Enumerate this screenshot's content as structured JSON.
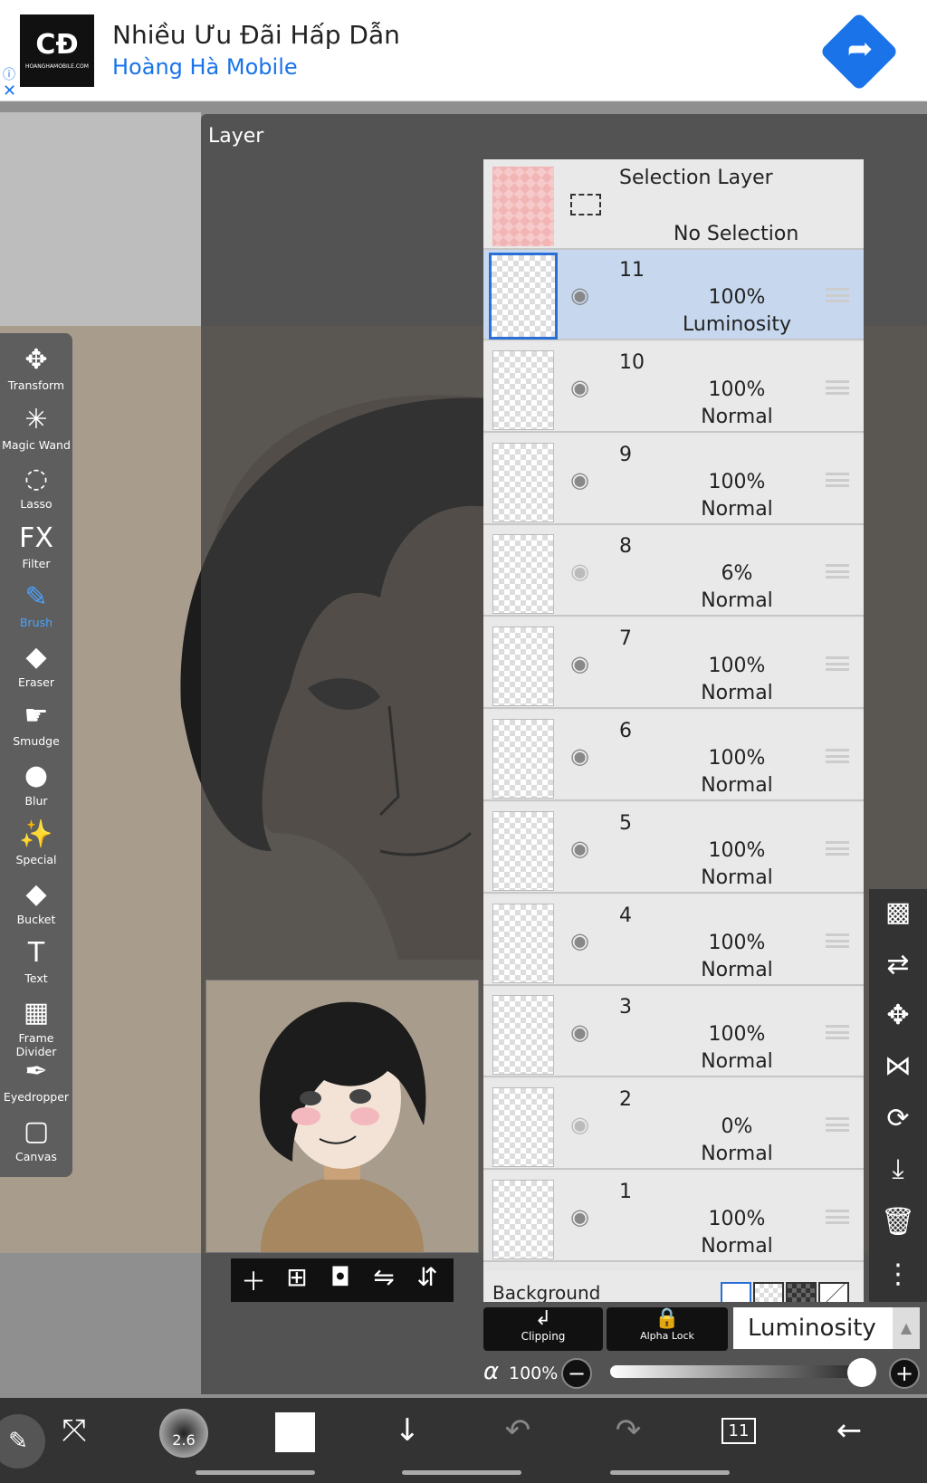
{
  "ad": {
    "title": "Nhiều Ưu Đãi Hấp Dẫn",
    "subtitle": "Hoàng Hà Mobile",
    "logo_text": "CĐ",
    "logo_small": "HOANGHAMOBILE.COM"
  },
  "panel": {
    "title": "Layer"
  },
  "tools": [
    {
      "label": "Transform",
      "icon": "move-icon",
      "glyph": "✥"
    },
    {
      "label": "Magic Wand",
      "icon": "magic-wand-icon",
      "glyph": "✳"
    },
    {
      "label": "Lasso",
      "icon": "lasso-icon",
      "glyph": "◌"
    },
    {
      "label": "Filter",
      "icon": "fx-icon",
      "glyph": "FX"
    },
    {
      "label": "Brush",
      "icon": "brush-icon",
      "glyph": "✎"
    },
    {
      "label": "Eraser",
      "icon": "eraser-icon",
      "glyph": "◆"
    },
    {
      "label": "Smudge",
      "icon": "smudge-icon",
      "glyph": "☛"
    },
    {
      "label": "Blur",
      "icon": "blur-icon",
      "glyph": "●"
    },
    {
      "label": "Special",
      "icon": "special-icon",
      "glyph": "✨"
    },
    {
      "label": "Bucket",
      "icon": "bucket-icon",
      "glyph": "◆"
    },
    {
      "label": "Text",
      "icon": "text-icon",
      "glyph": "T"
    },
    {
      "label": "Frame Divider",
      "icon": "frame-divider-icon",
      "glyph": "▦"
    },
    {
      "label": "Eyedropper",
      "icon": "eyedropper-icon",
      "glyph": "✒"
    },
    {
      "label": "Canvas",
      "icon": "canvas-icon",
      "glyph": "▢"
    }
  ],
  "selection_layer": {
    "title": "Selection Layer",
    "status": "No Selection"
  },
  "layers": [
    {
      "num": "11",
      "opacity": "100%",
      "mode": "Luminosity",
      "visible": true,
      "selected": true
    },
    {
      "num": "10",
      "opacity": "100%",
      "mode": "Normal",
      "visible": true
    },
    {
      "num": "9",
      "opacity": "100%",
      "mode": "Normal",
      "visible": true
    },
    {
      "num": "8",
      "opacity": "6%",
      "mode": "Normal",
      "visible": false
    },
    {
      "num": "7",
      "opacity": "100%",
      "mode": "Normal",
      "visible": true
    },
    {
      "num": "6",
      "opacity": "100%",
      "mode": "Normal",
      "visible": true
    },
    {
      "num": "5",
      "opacity": "100%",
      "mode": "Normal",
      "visible": true
    },
    {
      "num": "4",
      "opacity": "100%",
      "mode": "Normal",
      "visible": true
    },
    {
      "num": "3",
      "opacity": "100%",
      "mode": "Normal",
      "visible": true
    },
    {
      "num": "2",
      "opacity": "0%",
      "mode": "Normal",
      "visible": false
    },
    {
      "num": "1",
      "opacity": "100%",
      "mode": "Normal",
      "visible": true
    }
  ],
  "background": {
    "label": "Background"
  },
  "controls": {
    "clipping": "Clipping",
    "alpha_lock": "Alpha Lock",
    "blend_mode": "Luminosity",
    "alpha_symbol": "α",
    "opacity": "100%",
    "opacity_value": 1.0
  },
  "bottom": {
    "brush_size": "2.6",
    "layer_count": "11"
  },
  "colors": {
    "selected_row": "#c7d8ee",
    "accent": "#4aa3ff",
    "canvas_bg": "#a89c8d",
    "skin": "#a6875f"
  }
}
